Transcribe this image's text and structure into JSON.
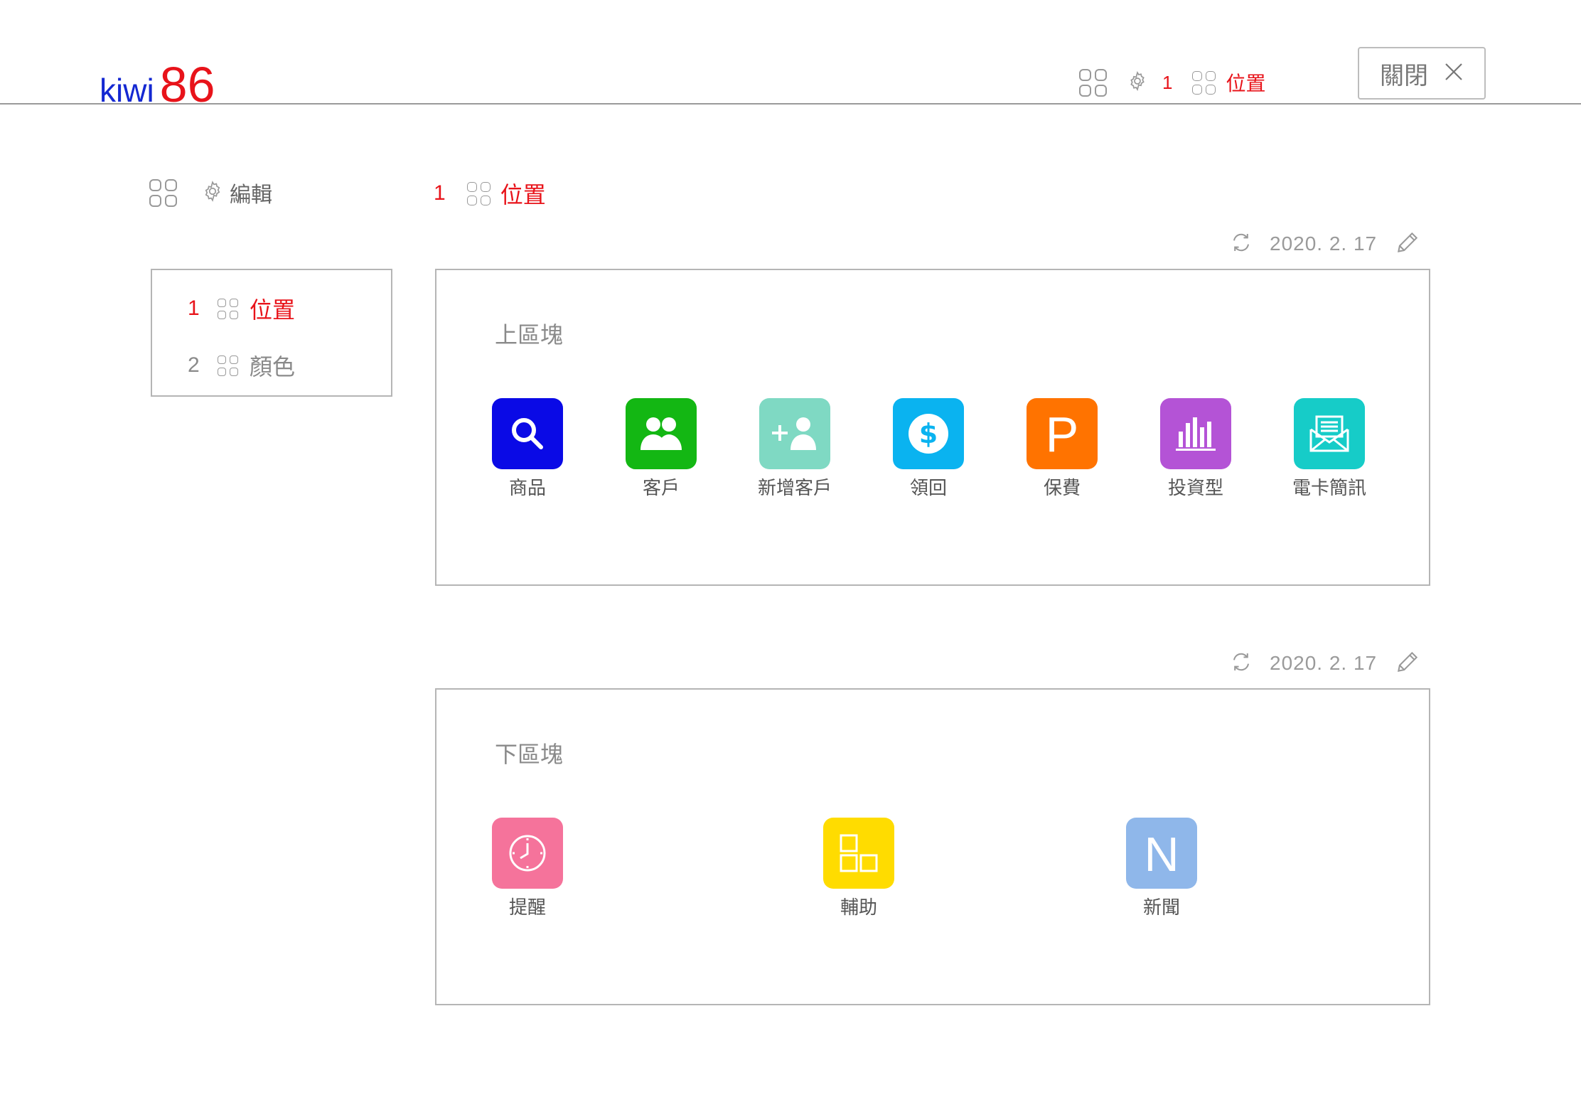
{
  "header": {
    "logo_text": "kiwi",
    "logo_number": "86",
    "crumb_number": "1",
    "crumb_label": "位置",
    "close_label": "關閉"
  },
  "subheader": {
    "edit_label": "編輯",
    "crumb_number": "1",
    "crumb_label": "位置"
  },
  "sidebar": {
    "items": [
      {
        "number": "1",
        "label": "位置",
        "active": true
      },
      {
        "number": "2",
        "label": "顏色",
        "active": false
      }
    ]
  },
  "panels": [
    {
      "date": "2020. 2. 17",
      "title": "上區塊",
      "apps": [
        {
          "label": "商品",
          "icon": "search-icon",
          "color": "#0a0ae6"
        },
        {
          "label": "客戶",
          "icon": "people-icon",
          "color": "#13b713"
        },
        {
          "label": "新增客戶",
          "icon": "add-user-icon",
          "color": "#7fd9c3"
        },
        {
          "label": "領回",
          "icon": "dollar-icon",
          "color": "#0ab3f0"
        },
        {
          "label": "保費",
          "icon": "p-letter-icon",
          "color": "#ff7300"
        },
        {
          "label": "投資型",
          "icon": "bar-chart-icon",
          "color": "#b453d6"
        },
        {
          "label": "電卡簡訊",
          "icon": "mail-icon",
          "color": "#16ccc8"
        }
      ]
    },
    {
      "date": "2020. 2. 17",
      "title": "下區塊",
      "apps": [
        {
          "label": "提醒",
          "icon": "clock-icon",
          "color": "#f5739b"
        },
        {
          "label": "輔助",
          "icon": "squares-icon",
          "color": "#ffdc00"
        },
        {
          "label": "新聞",
          "icon": "n-letter-icon",
          "color": "#8fb7ea"
        }
      ]
    }
  ],
  "colors": {
    "accent_red": "#e8131a",
    "logo_blue": "#1428d2",
    "border_gray": "#b5b5b5"
  }
}
